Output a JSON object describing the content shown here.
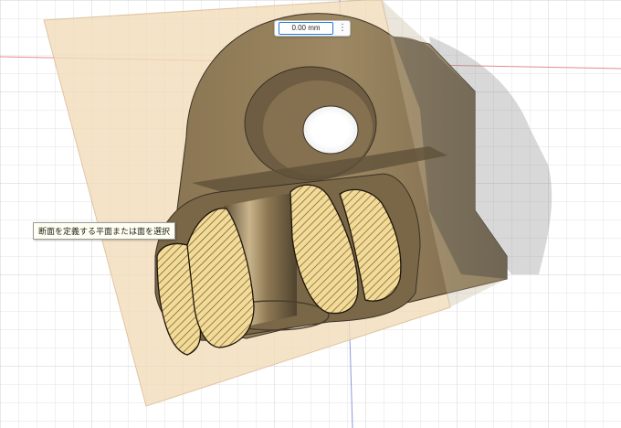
{
  "dimension_input": {
    "value": "0.00 mm",
    "menu_icon": "more-vertical-icon"
  },
  "tooltip": {
    "text": "断面を定義する平面または面を選択"
  },
  "colors": {
    "grid_line": "#e4e4e4",
    "grid_major": "#d2d2d2",
    "section_plane": "#f0dcbf",
    "body_dark": "#6e5d43",
    "body_mid": "#9a8561",
    "cut_face": "#f3dc9a",
    "hatch": "#6b5020",
    "axis_red": "#e58a8a",
    "axis_blue": "#8c9ae0",
    "input_border": "#1f7ad6"
  }
}
